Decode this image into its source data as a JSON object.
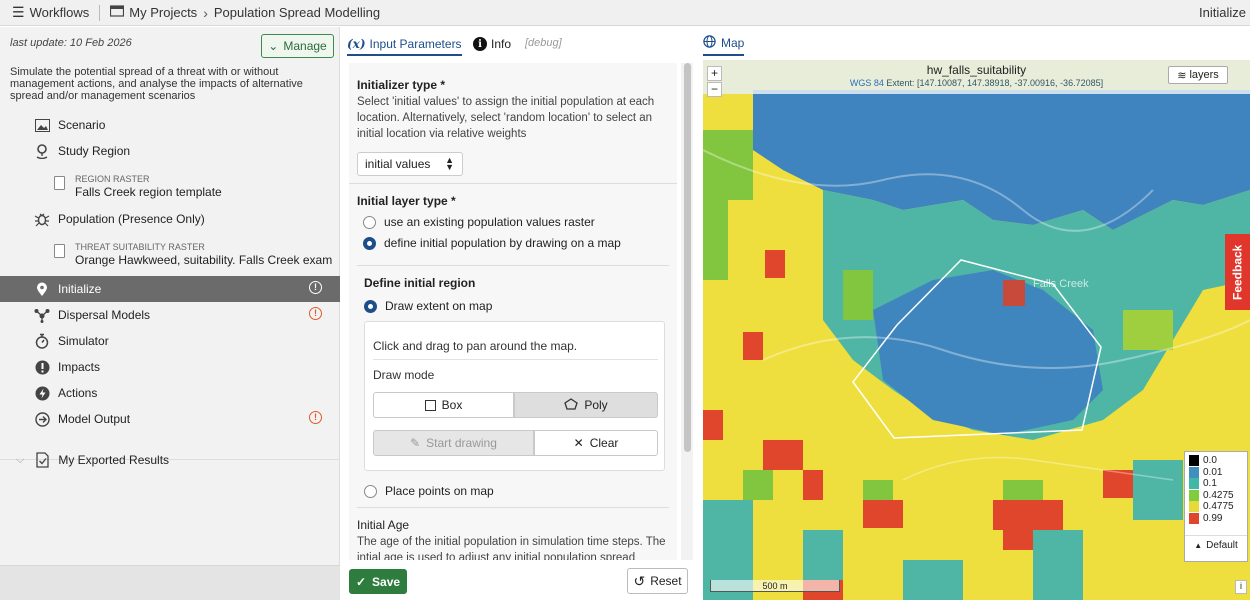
{
  "topbar": {
    "workflows": "Workflows",
    "projects": "My Projects",
    "project_name": "Population Spread Modelling",
    "right_label": "Initialize"
  },
  "sidebar": {
    "last_update": "last update: 10 Feb 2026",
    "manage": "Manage",
    "description": "Simulate the potential spread of a threat with or without management actions, and analyse the impacts of alternative spread and/or management scenarios",
    "items": [
      {
        "label": "Scenario",
        "icon": "image-icon"
      },
      {
        "label": "Study Region",
        "icon": "location-icon"
      },
      {
        "label": "Population (Presence Only)",
        "icon": "bug-icon"
      },
      {
        "label": "Initialize",
        "icon": "pin-icon",
        "warning": "!"
      },
      {
        "label": "Dispersal Models",
        "icon": "network-icon",
        "warning": "!"
      },
      {
        "label": "Simulator",
        "icon": "stopwatch-icon"
      },
      {
        "label": "Impacts",
        "icon": "alert-icon"
      },
      {
        "label": "Actions",
        "icon": "bolt-icon"
      },
      {
        "label": "Model Output",
        "icon": "arrow-circle-icon",
        "warning": "!"
      }
    ],
    "region_raster_label": "REGION RASTER",
    "region_raster_value": "Falls Creek region template",
    "threat_raster_label": "THREAT SUITABILITY RASTER",
    "threat_raster_value": "Orange Hawkweed, suitability. Falls Creek example",
    "exported": "My Exported Results"
  },
  "panel": {
    "tab_input": "Input Parameters",
    "tab_input_fx": "(x)",
    "tab_info": "Info",
    "tab_debug": "[debug]",
    "init_type_title": "Initializer type *",
    "init_type_help": "Select 'initial values' to assign the initial population at each location. Alternatively, select 'random location' to select an initial location via relative weights",
    "init_type_value": "initial values",
    "layer_type_title": "Initial layer type *",
    "layer_opt1": "use an existing population values raster",
    "layer_opt2": "define initial population by drawing on a map",
    "region_title": "Define initial region",
    "draw_extent": "Draw extent on map",
    "pan_hint": "Click and drag to pan around the map.",
    "draw_mode": "Draw mode",
    "box": "Box",
    "poly": "Poly",
    "start_drawing": "Start drawing",
    "clear": "Clear",
    "place_points": "Place points on map",
    "initial_age_title": "Initial Age",
    "initial_age_help": "The age of the initial population in simulation time steps. The intial age is used to adjust any initial population spread",
    "save": "Save",
    "reset": "Reset"
  },
  "map": {
    "tab": "Map",
    "layer_name": "hw_falls_suitability",
    "crs": "WGS 84",
    "extent": "Extent: [147.10087, 147.38918, -37.00916, -36.72085]",
    "layers_btn": "layers",
    "zoom_in": "+",
    "zoom_out": "−",
    "feedback": "Feedback",
    "scale": "500 m",
    "info_btn": "i",
    "place_label": "Falls Creek",
    "legend": [
      {
        "label": "0.0",
        "color": "#000000"
      },
      {
        "label": "0.01",
        "color": "#3f8fbf"
      },
      {
        "label": "0.1",
        "color": "#3fb8a8"
      },
      {
        "label": "0.4275",
        "color": "#7fcc3f"
      },
      {
        "label": "0.4775",
        "color": "#e7d83b"
      },
      {
        "label": "0.99",
        "color": "#e0462b"
      }
    ],
    "legend_default": "Default"
  }
}
